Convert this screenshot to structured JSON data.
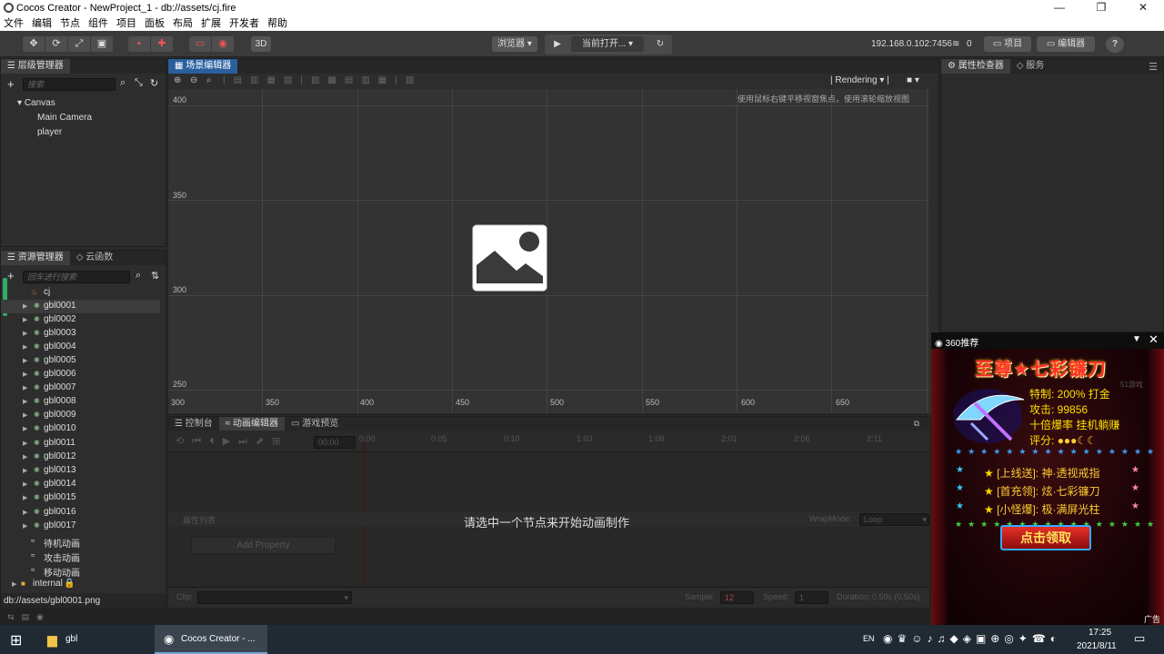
{
  "window": {
    "title": "Cocos Creator - NewProject_1 - db://assets/cj.fire"
  },
  "menu": [
    "文件",
    "编辑",
    "节点",
    "组件",
    "项目",
    "面板",
    "布局",
    "扩展",
    "开发者",
    "帮助"
  ],
  "toolbar": {
    "btn3d": "3D",
    "browser": "浏览器 ▾",
    "scene_select": "当前打开...",
    "ip": "192.168.0.102:7456",
    "ip_count": "0",
    "project": "项目",
    "editor": "编辑器",
    "help": "?"
  },
  "hierarchy": {
    "tab": "层级管理器",
    "search_placeholder": "搜索",
    "root": "Canvas",
    "children": [
      "Main Camera",
      "player"
    ]
  },
  "scene_editor": {
    "tab": "场景编辑器",
    "rendering": "Rendering",
    "hint": "使用鼠标右键平移视窗焦点，使用滚轮缩放视图",
    "y_ticks": [
      "400",
      "350",
      "300",
      "250"
    ],
    "x_ticks": [
      "300",
      "350",
      "400",
      "450",
      "500",
      "550",
      "600",
      "650"
    ]
  },
  "assets": {
    "tab": "资源管理器",
    "tab2": "云函数",
    "search_placeholder": "回车进行搜索",
    "top": "cj",
    "items": [
      "gbl0001",
      "gbl0002",
      "gbl0003",
      "gbl0004",
      "gbl0005",
      "gbl0006",
      "gbl0007",
      "gbl0008",
      "gbl0009",
      "gbl0010",
      "gbl0011",
      "gbl0012",
      "gbl0013",
      "gbl0014",
      "gbl0015",
      "gbl0016",
      "gbl0017"
    ],
    "anims": [
      "待机动画",
      "攻击动画",
      "移动动画"
    ],
    "internal": "internal",
    "path": "db://assets/gbl0001.png"
  },
  "inspector": {
    "tab": "属性检查器",
    "tab2": "服务"
  },
  "bottom": {
    "tabs": [
      "控制台",
      "动画编辑器",
      "游戏预览"
    ],
    "time_input": "00:00",
    "times": [
      "0:00",
      "0:05",
      "0:10",
      "1:03",
      "1:08",
      "2:01",
      "2:06",
      "2:11"
    ],
    "prop_list": "属性列表",
    "wrapmode_label": "WrapMode:",
    "wrapmode": "Loop",
    "message": "请选中一个节点来开始动画制作",
    "add_property": "Add Property",
    "clip_label": "Clip:",
    "sample_label": "Sample:",
    "sample": "12",
    "speed_label": "Speed:",
    "speed": "1",
    "duration": "Duration: 0.50s (0.50s)"
  },
  "popup": {
    "header": "360推荐",
    "title": "至尊★七彩镰刀",
    "small": "51游戏",
    "l1": "特制: 200% 打金",
    "l2": "攻击: 99856",
    "l3": "十倍爆率  挂机躺赚",
    "l4": "评分:",
    "o1": "[上线送]: 神·透视戒指",
    "o2": "[首充领]: 炫·七彩镰刀",
    "o3": "[小怪爆]: 极·满屏光柱",
    "button": "点击领取",
    "ad": "广告"
  },
  "taskbar": {
    "folder": "gbl",
    "app": "Cocos Creator - ...",
    "ime": "EN",
    "time": "17:25",
    "date": "2021/8/11"
  }
}
